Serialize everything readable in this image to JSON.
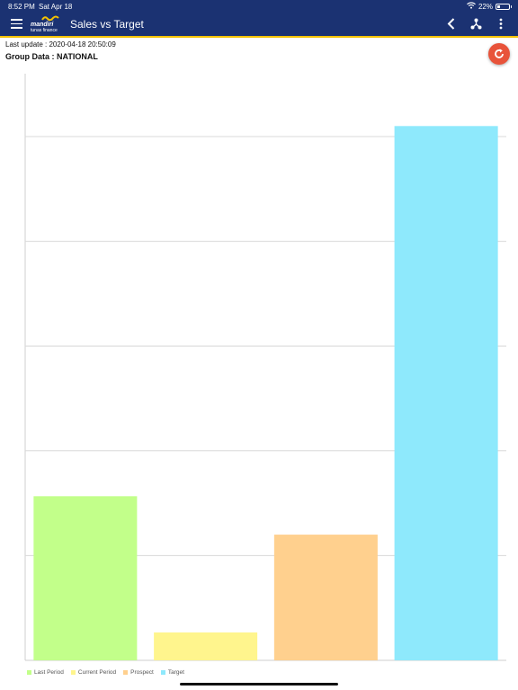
{
  "status_bar": {
    "time": "8:52 PM",
    "date": "Sat Apr 18",
    "battery_text": "22%",
    "battery_level": 0.22
  },
  "app_bar": {
    "logo_line1": "mandiri",
    "logo_line2": "tunas finance",
    "title": "Sales vs Target",
    "icons": [
      "menu-icon",
      "back-icon",
      "share-icon",
      "more-icon"
    ]
  },
  "info": {
    "last_update": "Last update : 2020-04-18 20:50:09",
    "group_data": "Group Data : NATIONAL"
  },
  "colors": {
    "header_bg": "#1b3272",
    "accent": "#f5c200",
    "refresh_button": "#e8533a"
  },
  "chart_data": {
    "type": "bar",
    "categories": [
      "Last Period",
      "Current Period",
      "Prospect",
      "Target"
    ],
    "values": [
      4.7,
      0.8,
      3.6,
      15.3
    ],
    "colors": [
      "#c2ff8a",
      "#fff58d",
      "#ffd08e",
      "#8ee9fc"
    ],
    "ylim": [
      0,
      16.8
    ],
    "grid": true,
    "legend_position": "bottom-left",
    "value_labels_visible": false
  }
}
